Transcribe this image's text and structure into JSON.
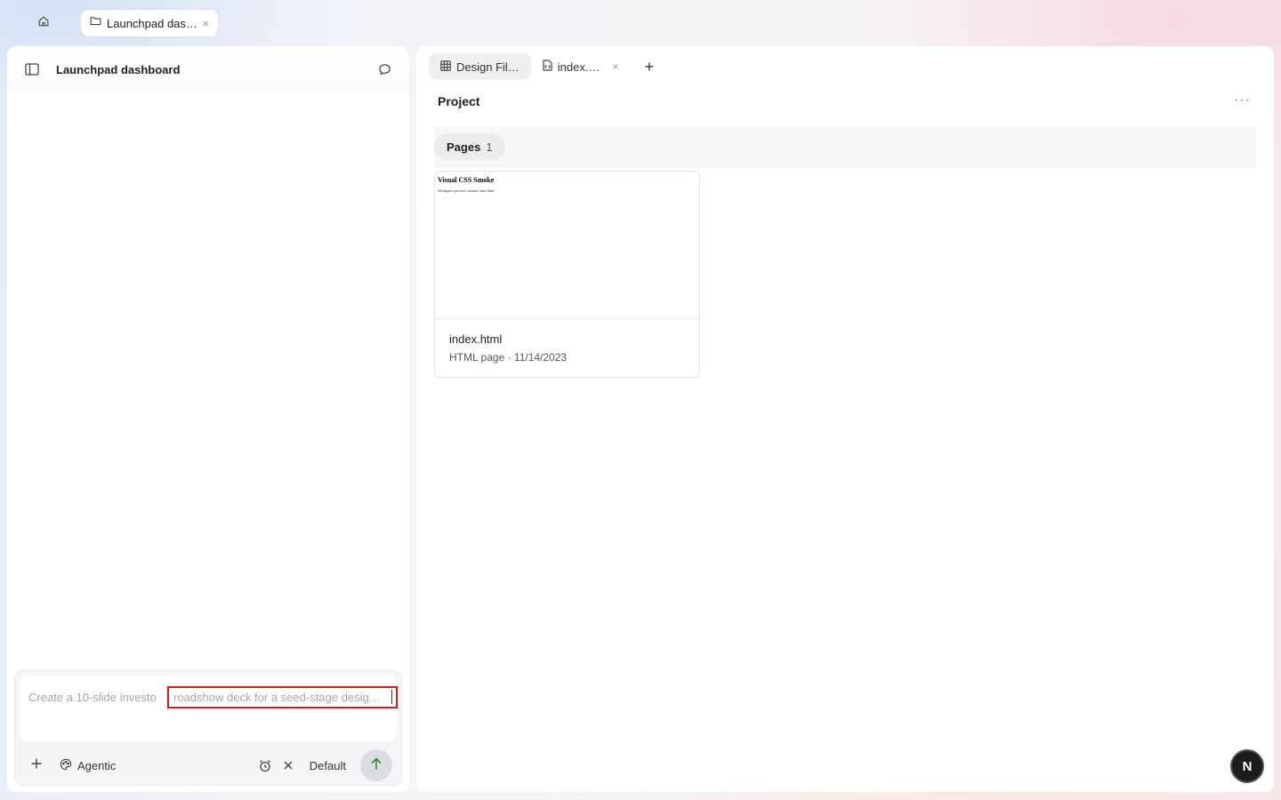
{
  "browser": {
    "tab_label": "Launchpad das…",
    "tab_close": "×"
  },
  "sidebar": {
    "title": "Launchpad dashboard"
  },
  "composer": {
    "placeholder_start": "Create a 10-slide investo",
    "placeholder_highlight": "roadshow deck for a seed-stage desig…",
    "mode_label": "Agentic",
    "model_label": "Default"
  },
  "editor": {
    "tabs": [
      {
        "label": "Design Fil…",
        "active": true
      },
      {
        "label": "index.…",
        "active": false,
        "close": "×"
      }
    ],
    "add_tab": "+",
    "project_title": "Project",
    "more": "···",
    "pages_label": "Pages",
    "pages_count": "1",
    "card": {
      "thumb_title": "Visual CSS Smoke",
      "thumb_subtitle": "Workspace preview contains inner html",
      "file_name": "index.html",
      "meta": "HTML page · 11/14/2023"
    }
  },
  "fab_label": "N",
  "colors": {
    "highlight_border": "#e0141b",
    "send_arrow": "#2a8a3a",
    "fab_bg": "#1c1c1c"
  }
}
